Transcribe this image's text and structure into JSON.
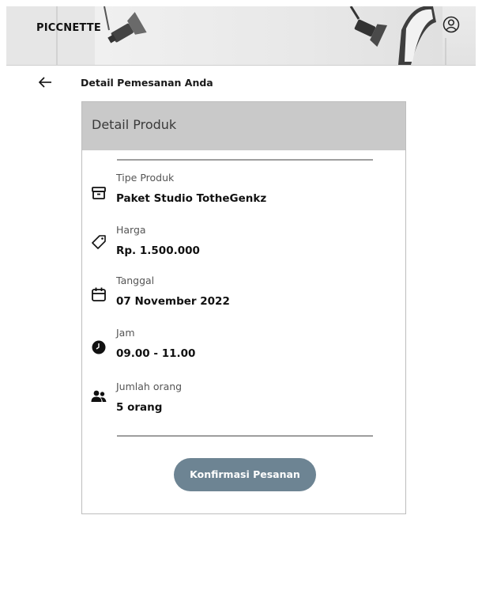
{
  "header": {
    "brand": "PICCNETTE",
    "profile_icon": "user-circle-icon"
  },
  "page": {
    "title": "Detail Pemesanan Anda",
    "back_icon": "arrow-left-icon"
  },
  "card": {
    "title": "Detail Produk",
    "items": [
      {
        "label": "Tipe Produk",
        "value": "Paket Studio TotheGenkz",
        "icon": "package-icon"
      },
      {
        "label": "Harga",
        "value": "Rp. 1.500.000",
        "icon": "price-tag-icon"
      },
      {
        "label": "Tanggal",
        "value": "07 November 2022",
        "icon": "calendar-icon"
      },
      {
        "label": "Jam",
        "value": "09.00 - 11.00",
        "icon": "clock-icon"
      },
      {
        "label": "Jumlah orang",
        "value": "5 orang",
        "icon": "people-icon"
      }
    ],
    "confirm_label": "Konfirmasi Pesanan"
  },
  "colors": {
    "button": "#6d8493",
    "card_header": "#c9c9c9"
  }
}
